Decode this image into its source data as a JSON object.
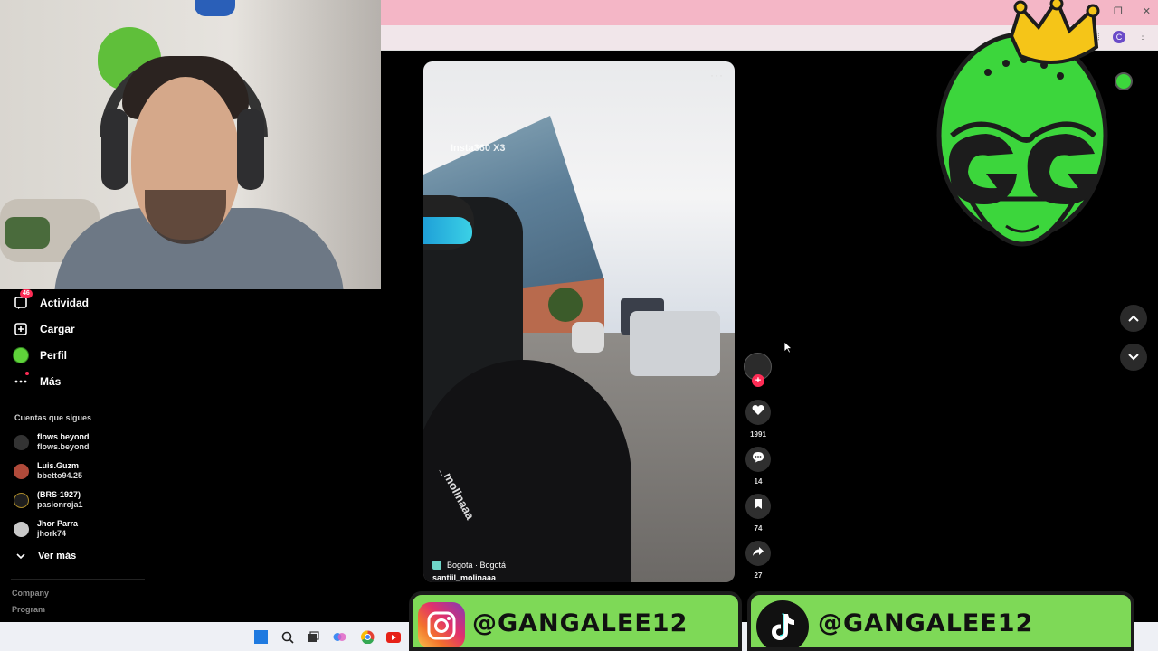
{
  "webcam": {
    "label": "webcam feed"
  },
  "browser": {
    "window_controls": [
      "–",
      "❐",
      "✕"
    ],
    "profile_initial": "C"
  },
  "sidebar": {
    "items": [
      {
        "label": "Actividad",
        "icon": "activity-icon",
        "badge": "46"
      },
      {
        "label": "Cargar",
        "icon": "upload-icon"
      },
      {
        "label": "Perfil",
        "icon": "profile-avatar-icon"
      },
      {
        "label": "Más",
        "icon": "more-dots-icon"
      }
    ],
    "following_title": "Cuentas que sigues",
    "following": [
      {
        "name": "flows beyond",
        "user": "flows.beyond"
      },
      {
        "name": "Luis.Guzm",
        "user": "bbetto94.25"
      },
      {
        "name": "(BRS-1927)",
        "user": "pasionroja1"
      },
      {
        "name": "Jhor Parra",
        "user": "jhork74"
      }
    ],
    "see_more": "Ver más",
    "footer": [
      "Company",
      "Program"
    ]
  },
  "video": {
    "watermark": "Insta360  X3",
    "more": "···",
    "location": "Bogota · Bogotá",
    "author": "santiil_molinaaa",
    "bike_sticker": "_molinaaa"
  },
  "actions": {
    "likes": "1991",
    "comments": "14",
    "saves": "74",
    "shares": "27"
  },
  "banners": {
    "instagram": "@GANGALEE12",
    "tiktok": "@GANGALEE12"
  },
  "colors": {
    "chrome_pink": "#f4b6c6",
    "banner_green": "#7ed957",
    "tiktok_red": "#fe2c55"
  }
}
